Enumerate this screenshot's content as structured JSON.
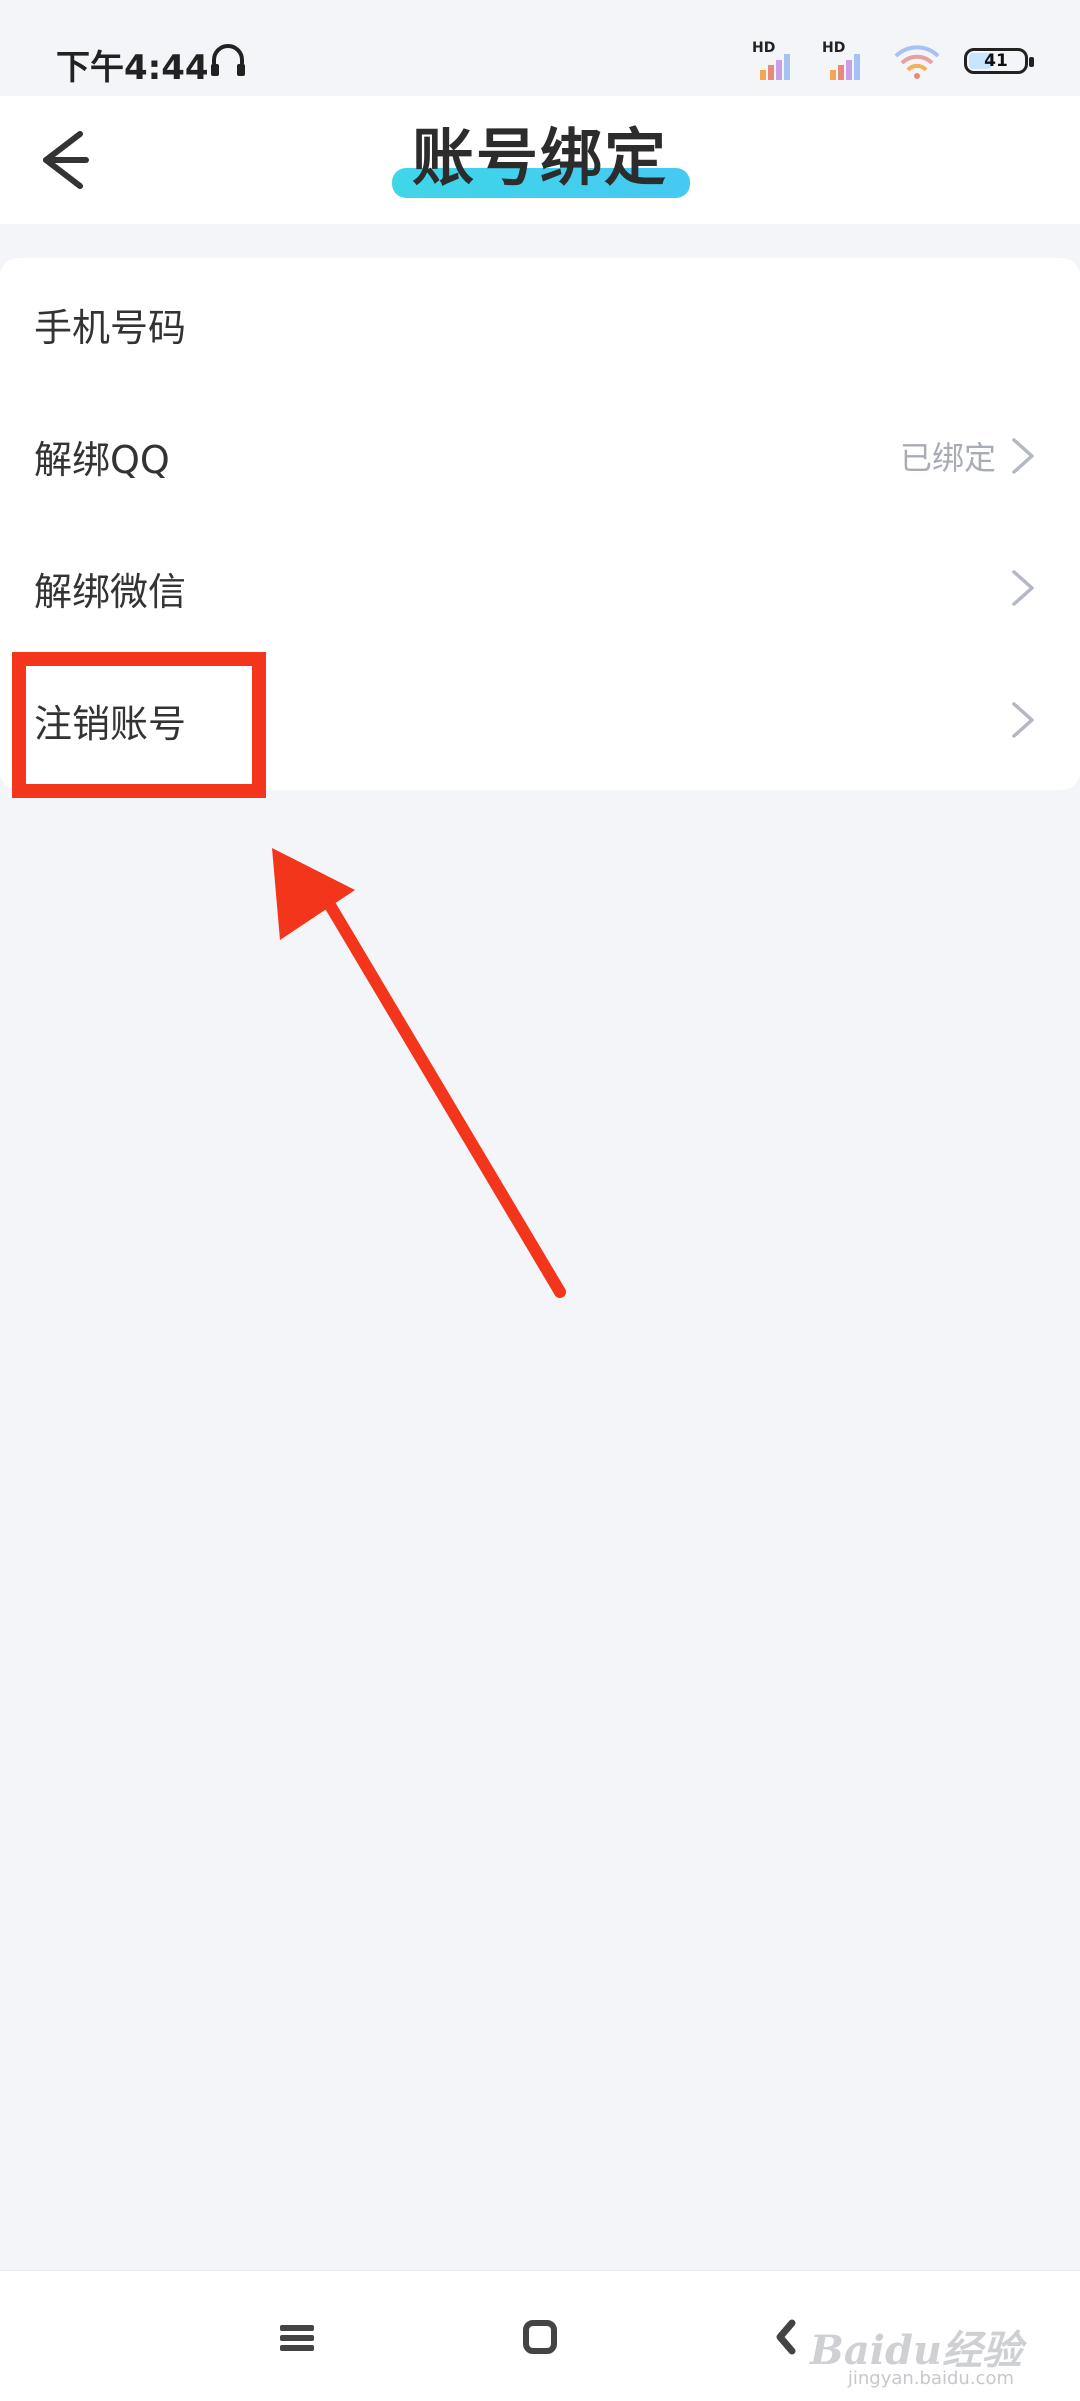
{
  "status_bar": {
    "time": "下午4:44",
    "signal_1_label": "HD",
    "signal_2_label": "HD",
    "battery_level": "41",
    "icons": [
      "headset-icon",
      "signal-icon",
      "signal-icon",
      "wifi-icon",
      "battery-icon"
    ]
  },
  "header": {
    "title": "账号绑定",
    "back_icon": "back-arrow-icon",
    "accent_color": "#3fd6e8"
  },
  "list": {
    "items": [
      {
        "label": "手机号码",
        "value": "",
        "has_chevron": false
      },
      {
        "label": "解绑QQ",
        "value": "已绑定",
        "has_chevron": true
      },
      {
        "label": "解绑微信",
        "value": "",
        "has_chevron": true
      },
      {
        "label": "注销账号",
        "value": "",
        "has_chevron": true
      }
    ]
  },
  "annotation": {
    "color": "#f3361b",
    "target": "注销账号"
  },
  "nav_bar": {
    "icons": [
      "menu-icon",
      "home-square-icon",
      "back-chevron-icon"
    ]
  },
  "watermark": {
    "text": "Baidu经验",
    "url": "jingyan.baidu.com"
  }
}
